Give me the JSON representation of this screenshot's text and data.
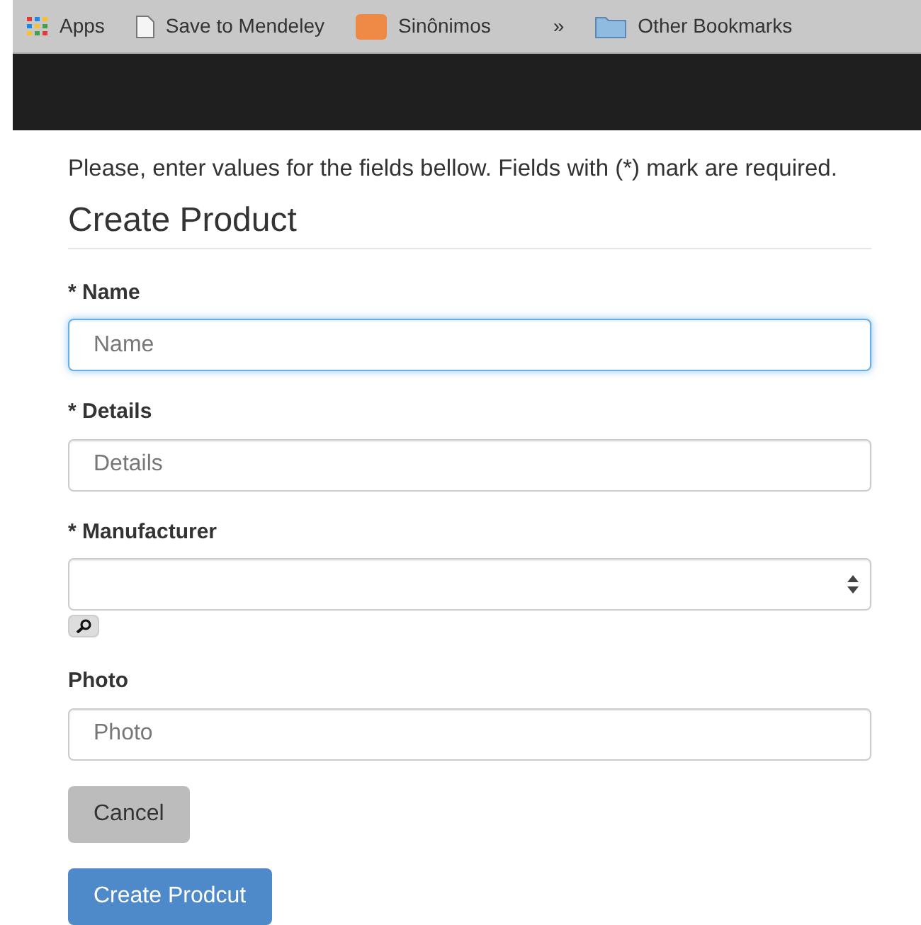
{
  "bookmarks": [
    {
      "label": "Apps",
      "kind": "apps"
    },
    {
      "label": "Save to Mendeley",
      "kind": "page"
    },
    {
      "label": "Sinônimos",
      "kind": "tile"
    },
    {
      "label": "»",
      "kind": "more"
    },
    {
      "label": "Other Bookmarks",
      "kind": "folder"
    }
  ],
  "intro": "Please, enter values for the fields bellow. Fields with (*) mark are required.",
  "heading": "Create Product",
  "fields": [
    {
      "label": "* Name",
      "kind": "text",
      "placeholder": "Name",
      "focused": true
    },
    {
      "label": "* Details",
      "kind": "text",
      "placeholder": "Details",
      "focused": false
    },
    {
      "label": "* Manufacturer",
      "kind": "select",
      "focused": false
    },
    {
      "label": "Photo",
      "kind": "text",
      "placeholder": "Photo",
      "focused": false
    }
  ],
  "buttons": [
    {
      "label": "Cancel",
      "kind": "secondary"
    },
    {
      "label": "Create Prodcut",
      "kind": "primary"
    }
  ]
}
